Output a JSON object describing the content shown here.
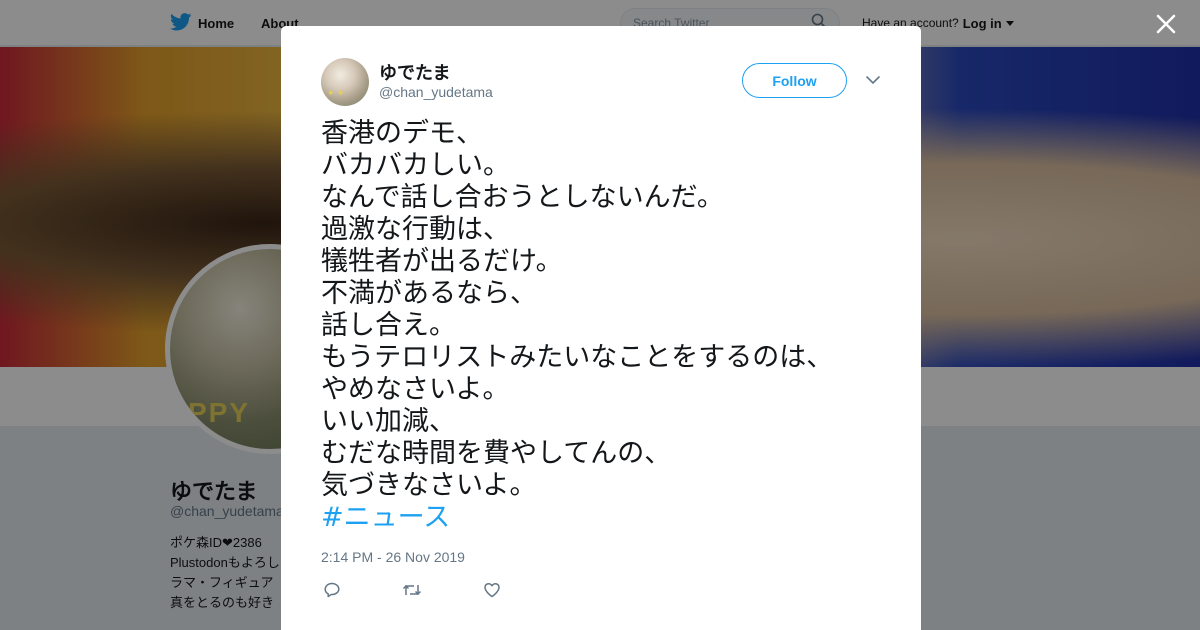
{
  "topbar": {
    "home_label": "Home",
    "about_label": "About",
    "search_placeholder": "Search Twitter",
    "account_prompt": "Have an account?",
    "login_label": "Log in"
  },
  "profile": {
    "name": "ゆでたま",
    "handle": "@chan_yudetama",
    "bio_lines": [
      "ポケ森ID❤2386",
      "Plustodonもよろし",
      "ラマ・フィギュア",
      "真をとるのも好き"
    ]
  },
  "tweet": {
    "name": "ゆでたま",
    "handle": "@chan_yudetama",
    "follow_label": "Follow",
    "lines": [
      "香港のデモ、",
      "バカバカしい。",
      "なんで話し合おうとしないんだ。",
      "過激な行動は、",
      "犠牲者が出るだけ。",
      "不満があるなら、",
      "話し合え。",
      "もうテロリストみたいなことをするのは、",
      "やめなさいよ。",
      "いい加減、",
      "むだな時間を費やしてんの、",
      "気づきなさいよ。"
    ],
    "hashtag": "#ニュース",
    "timestamp": "2:14 PM - 26 Nov 2019"
  },
  "colors": {
    "accent": "#1da1f2",
    "text": "#14171a",
    "secondary": "#657786"
  },
  "icons": [
    "twitter-bird-icon",
    "search-icon",
    "caret-down-icon",
    "close-icon",
    "chevron-down-icon",
    "reply-icon",
    "retweet-icon",
    "heart-icon"
  ]
}
